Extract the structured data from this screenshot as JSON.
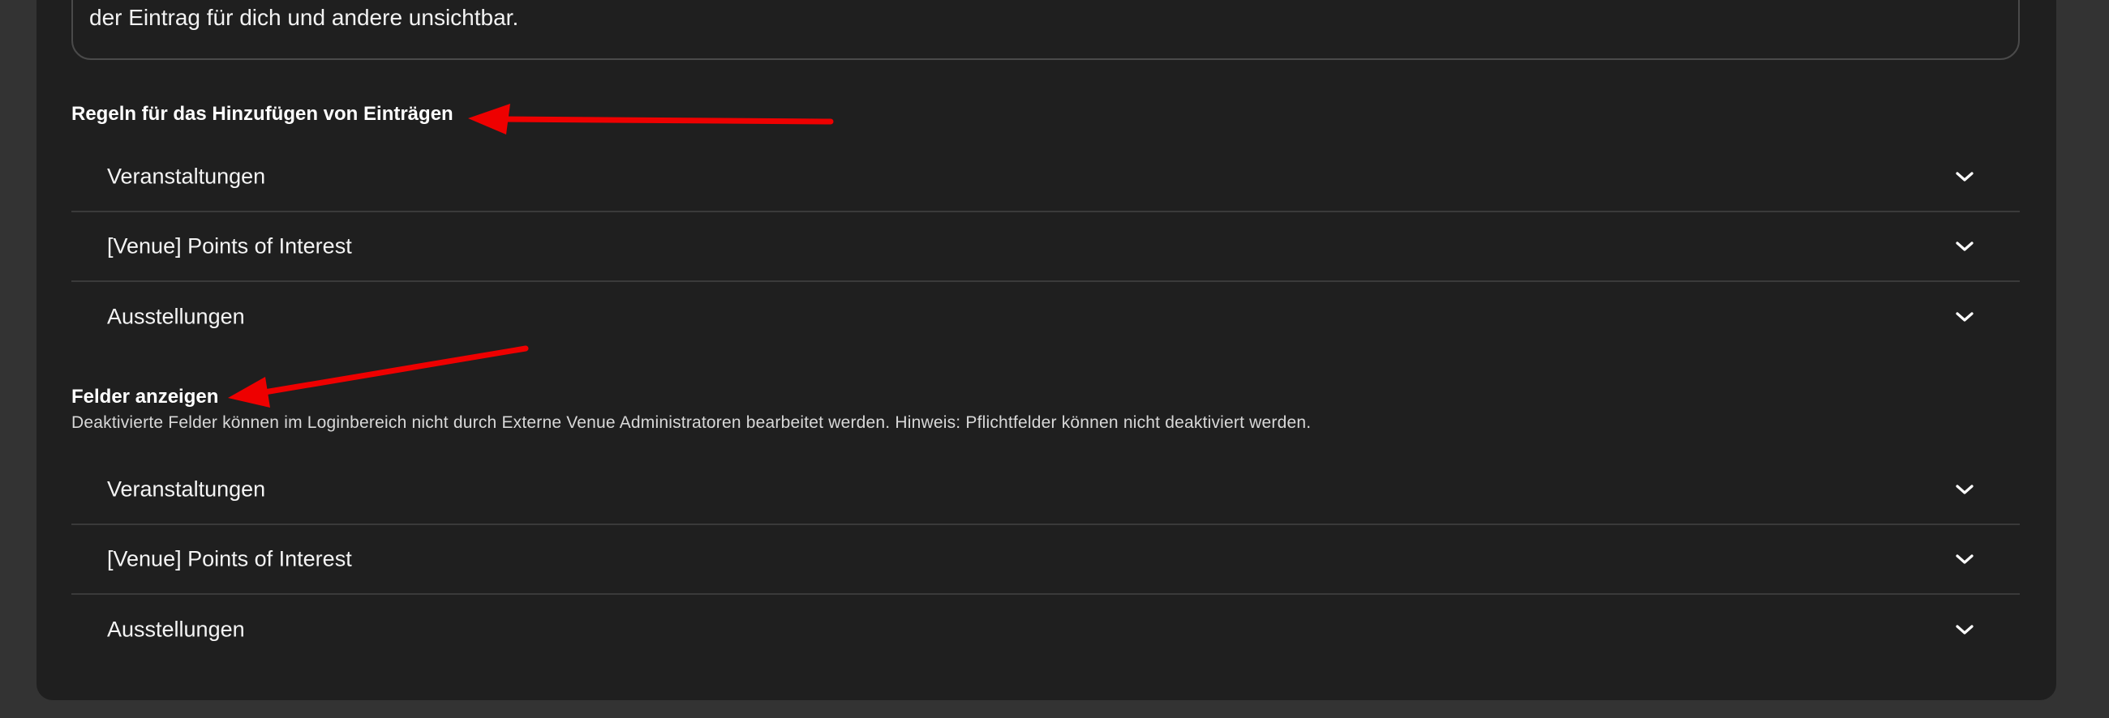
{
  "info_box": {
    "text": "der Eintrag für dich und andere unsichtbar."
  },
  "rules_section": {
    "title": "Regeln für das Hinzufügen von Einträgen",
    "items": [
      {
        "label": "Veranstaltungen"
      },
      {
        "label": "[Venue] Points of Interest"
      },
      {
        "label": "Ausstellungen"
      }
    ]
  },
  "fields_section": {
    "title": "Felder anzeigen",
    "description": "Deaktivierte Felder können im Loginbereich nicht durch Externe Venue Administratoren bearbeitet werden. Hinweis: Pflichtfelder können nicht deaktiviert werden.",
    "items": [
      {
        "label": "Veranstaltungen"
      },
      {
        "label": "[Venue] Points of Interest"
      },
      {
        "label": "Ausstellungen"
      }
    ]
  },
  "icons": {
    "expand": "chevron-down-icon",
    "annotation": "red-arrow-annotation"
  },
  "colors": {
    "background": "#333333",
    "panel": "#1f1f1f",
    "divider": "#3a3a3a",
    "annotation_arrow": "#ee0000"
  }
}
